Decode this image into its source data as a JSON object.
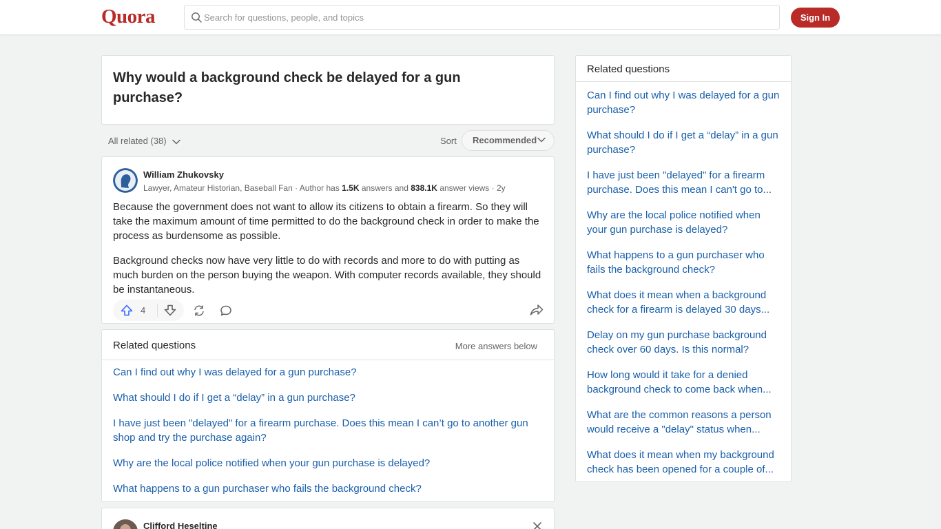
{
  "header": {
    "logo": "Quora",
    "search_placeholder": "Search for questions, people, and topics",
    "signin_label": "Sign In"
  },
  "question": {
    "title": "Why would a background check be delayed for a gun purchase?"
  },
  "filters": {
    "all_related": "All related (38)",
    "sort_label": "Sort",
    "sort_value": "Recommended"
  },
  "answer": {
    "author": "William Zhukovsky",
    "cred_prefix": "Lawyer, Amateur Historian, Baseball Fan · Author has ",
    "answers_count": "1.5K",
    "cred_mid": " answers and ",
    "views_count": "838.1K",
    "cred_suffix": " answer views · 2y",
    "paragraphs": [
      "Because the government does not want to allow its citizens to obtain a firearm. So they will take the maximum amount of time permitted to do the background check in order to make the process as burdensome as possible.",
      "Background checks now have very little to do with records and more to do with putting as much burden on the person buying the weapon. With computer records available, they should be instantaneous."
    ],
    "upvotes": "4"
  },
  "related_inline": {
    "title": "Related questions",
    "more": "More answers below",
    "items": [
      "Can I find out why I was delayed for a gun purchase?",
      "What should I do if I get a “delay” in a gun purchase?",
      "I have just been \"delayed\" for a firearm purchase. Does this mean I can’t go to another gun shop and try the purchase again?",
      "Why are the local police notified when your gun purchase is delayed?",
      "What happens to a gun purchaser who fails the background check?"
    ]
  },
  "next_answer": {
    "author": "Clifford Heseltine"
  },
  "sidebar": {
    "title": "Related questions",
    "items": [
      "Can I find out why I was delayed for a gun purchase?",
      "What should I do if I get a “delay” in a gun purchase?",
      "I have just been \"delayed\" for a firearm purchase. Does this mean I can't go to...",
      "Why are the local police notified when your gun purchase is delayed?",
      "What happens to a gun purchaser who fails the background check?",
      "What does it mean when a background check for a firearm is delayed 30 days...",
      "Delay on my gun purchase background check over 60 days. Is this normal?",
      "How long would it take for a denied background check to come back when...",
      "What are the common reasons a person would receive a \"delay\" status when...",
      "What does it mean when my background check has been opened for a couple of..."
    ]
  },
  "colors": {
    "brand": "#b92b27",
    "link": "#195faa",
    "upvote": "#2e69ff",
    "background": "#f1f2f2"
  }
}
